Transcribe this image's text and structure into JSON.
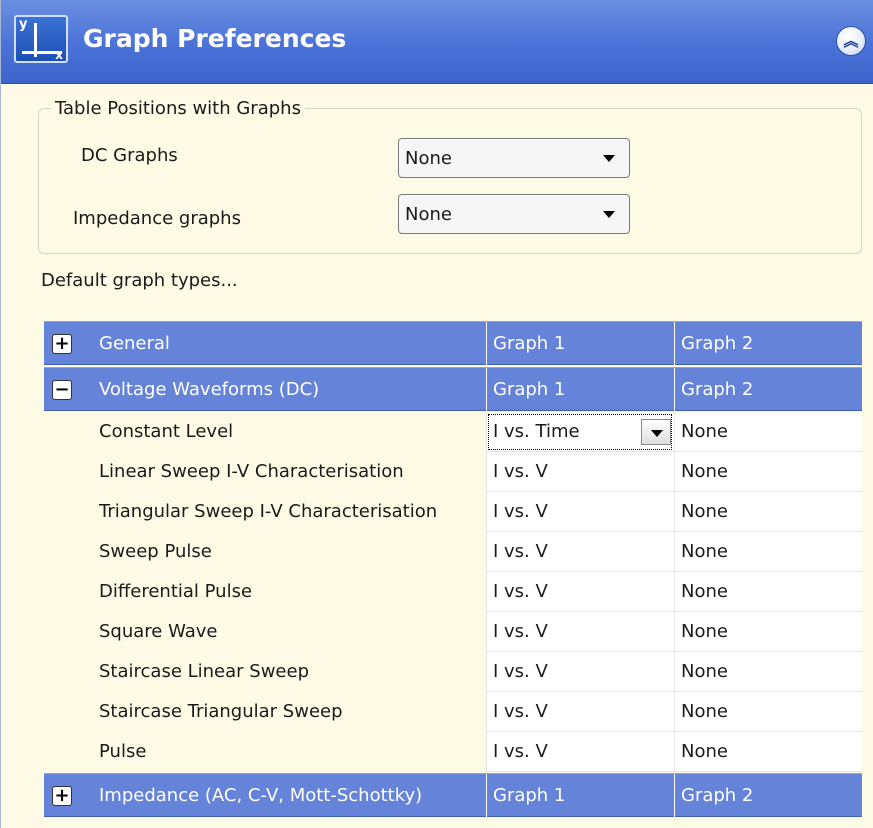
{
  "header": {
    "title": "Graph Preferences",
    "icon": "graph-axes-icon",
    "icon_labels": {
      "y": "y",
      "x": "x"
    },
    "collapse_glyph": "︽"
  },
  "table_positions": {
    "legend": "Table Positions with Graphs",
    "dc_label": "DC Graphs",
    "dc_value": "None",
    "impedance_label": "Impedance graphs",
    "impedance_value": "None"
  },
  "default_label": "Default graph types...",
  "grid": {
    "groups": [
      {
        "expander": "+",
        "name": "General",
        "col1": "Graph 1",
        "col2": "Graph 2"
      },
      {
        "expander": "−",
        "name": "Voltage Waveforms (DC)",
        "col1": "Graph 1",
        "col2": "Graph 2"
      },
      {
        "expander": "+",
        "name": "Impedance (AC, C-V, Mott-Schottky)",
        "col1": "Graph 1",
        "col2": "Graph 2"
      }
    ],
    "items": [
      {
        "name": "Constant Level",
        "graph1": "I vs. Time",
        "graph2": "None"
      },
      {
        "name": "Linear Sweep I-V Characterisation",
        "graph1": "I vs. V",
        "graph2": "None"
      },
      {
        "name": "Triangular Sweep I-V Characterisation",
        "graph1": "I vs. V",
        "graph2": "None"
      },
      {
        "name": "Sweep Pulse",
        "graph1": "I vs. V",
        "graph2": "None"
      },
      {
        "name": "Differential Pulse",
        "graph1": "I vs. V",
        "graph2": "None"
      },
      {
        "name": "Square Wave",
        "graph1": "I vs. V",
        "graph2": "None"
      },
      {
        "name": "Staircase Linear Sweep",
        "graph1": "I vs. V",
        "graph2": "None"
      },
      {
        "name": "Staircase Triangular Sweep",
        "graph1": "I vs. V",
        "graph2": "None"
      },
      {
        "name": "Pulse",
        "graph1": "I vs. V",
        "graph2": "None"
      }
    ]
  },
  "colors": {
    "header_blue": "#4a72d8",
    "group_row_blue": "#6583d8",
    "panel_bg": "#fdfbe6"
  }
}
